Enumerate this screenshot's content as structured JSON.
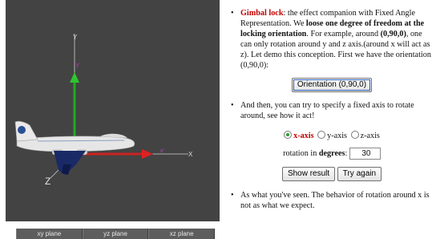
{
  "viewport": {
    "axis_y_label": "Y",
    "axis_x_label": "X",
    "axis_z_label": "Z",
    "body_y_label": "y'",
    "body_x_label": "x'"
  },
  "plane_buttons": [
    {
      "label": "xy plane"
    },
    {
      "label": "yz plane"
    },
    {
      "label": "xz plane"
    }
  ],
  "panel": {
    "item1": {
      "term": "Gimbal lock",
      "t1": ": the effect companion with Fixed Angle Representation. We ",
      "b1": "loose one degree of freedom at the locking orientation",
      "t2": ". For example, around ",
      "b2": "(0,90,0)",
      "t3": ", one can only rotation around y and z axis.(around x will act as z). Let demo this conception. First we have the orientation (0,90,0):"
    },
    "orientation_button": "Orientation (0,90,0)",
    "item2_text": "And then, you can try to specify a fixed axis to rotate around, see how it act!",
    "radios": [
      {
        "label": "x-axis",
        "selected": true
      },
      {
        "label": "y-axis",
        "selected": false
      },
      {
        "label": "z-axis",
        "selected": false
      }
    ],
    "rotation_label_pre": "rotation in ",
    "rotation_label_bold": "degrees",
    "rotation_label_post": ":",
    "rotation_value": "30",
    "show_result_button": "Show result",
    "try_again_button": "Try again",
    "item3_text": "As what you've seen. The behavior of rotation around x is not as what we expect."
  },
  "colors": {
    "viewport_bg": "#434343",
    "y_axis": "#22aa22",
    "x_axis": "#cc2222",
    "highlight_red": "#c00000"
  }
}
